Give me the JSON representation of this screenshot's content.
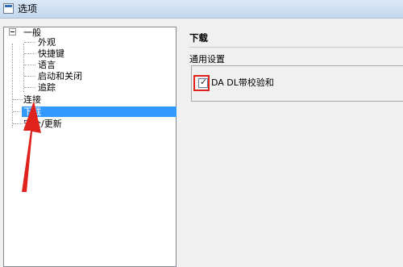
{
  "window": {
    "title": "选项"
  },
  "tree": {
    "root_label": "一般",
    "children": [
      "外观",
      "快捷键",
      "语言",
      "启动和关闭",
      "追踪"
    ],
    "items": [
      "连接",
      "下载",
      "安全/更新"
    ]
  },
  "panel": {
    "header": "下载",
    "group_label": "通用设置",
    "checkbox_label": "DA DL带校验和",
    "checkbox_checked": true
  },
  "annotation": {
    "color": "#e0221c"
  }
}
